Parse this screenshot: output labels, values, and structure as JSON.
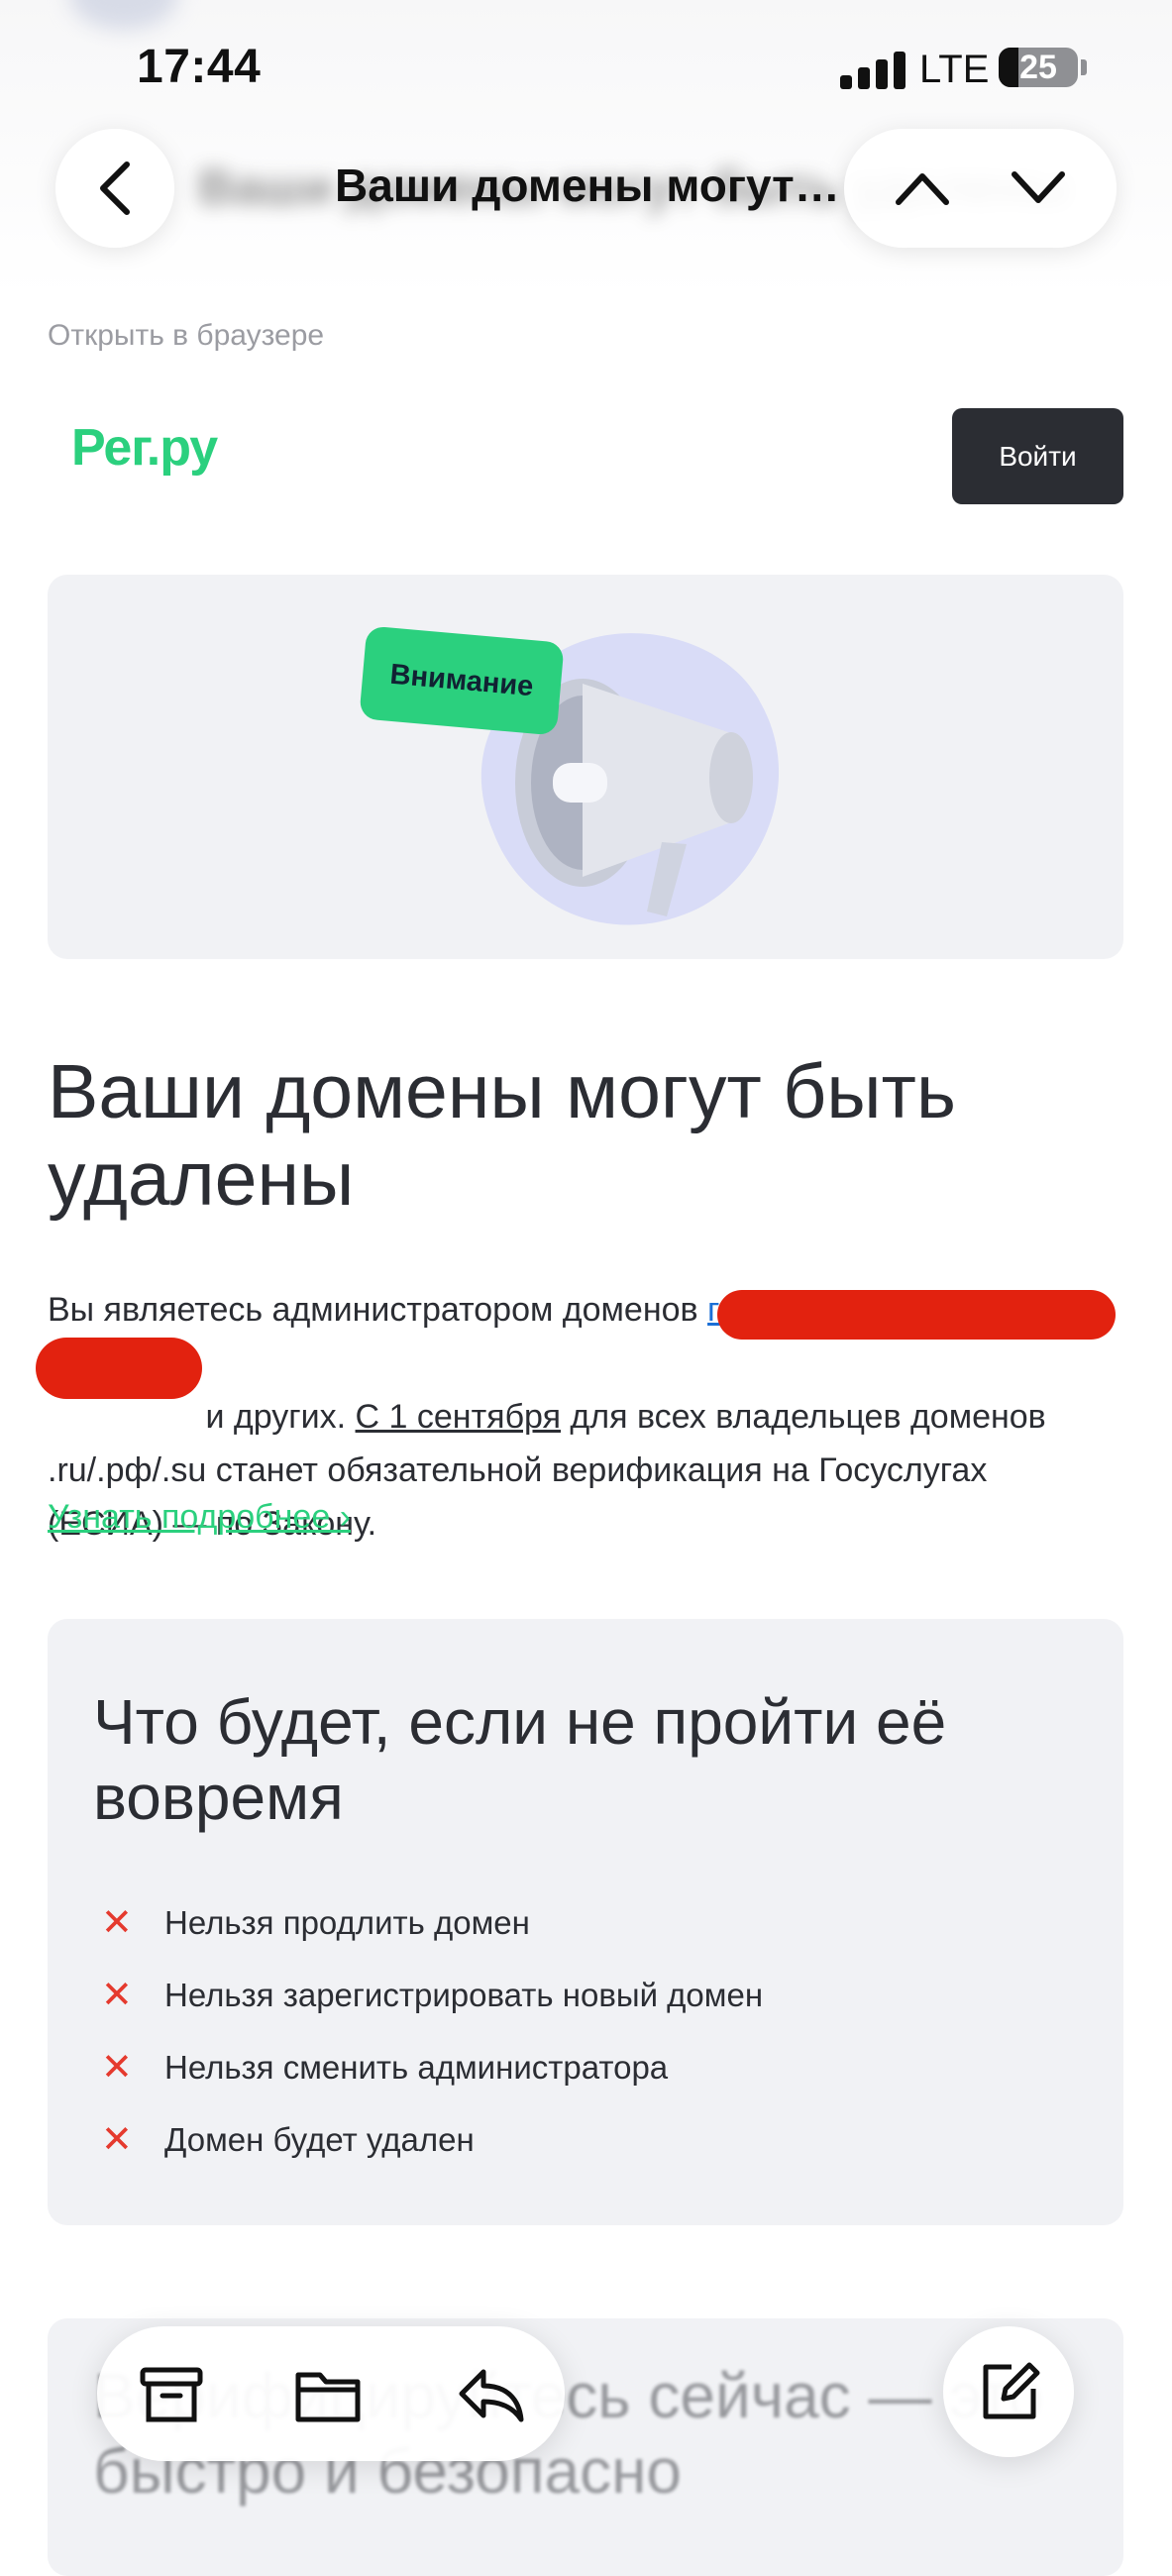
{
  "status_bar": {
    "time": "17:44",
    "network": "LTE",
    "battery": "25",
    "battery_level": 0.25
  },
  "nav": {
    "title": "Ваши домены могут…"
  },
  "email": {
    "open_in_browser": "Открыть в браузере",
    "logo": "Рег.ру",
    "login_label": "Войти",
    "hero_tag": "Внимание",
    "headline": "Ваши домены могут быть удалены",
    "body": {
      "part1": "Вы являетесь администратором доменов ",
      "link_fragment": "г",
      "part2": " и других. ",
      "date_phrase": "С 1 сентября",
      "part3": " для всех владельцев доменов .ru/.рф/.su станет обязательной верификация на Госуслугах (ЕСИА) — по Закону."
    },
    "learn_more": "Узнать подробнее ›",
    "consequences": {
      "title": "Что будет, если не пройти её вовремя",
      "items": [
        "Нельзя продлить домен",
        "Нельзя зарегистрировать новый домен",
        "Нельзя сменить администратора",
        "Домен будет удален"
      ]
    },
    "verify_heading": "Верифицируйтесь сейчас — это быстро и безопасно"
  },
  "colors": {
    "brand_green": "#2bd07e",
    "dark_button": "#2b2d33",
    "redaction": "#e2220f",
    "cross_red": "#e53a2e",
    "card_bg": "#f1f2f5"
  },
  "icons": [
    "back-chevron-icon",
    "chevron-up-icon",
    "chevron-down-icon",
    "archive-icon",
    "folder-icon",
    "reply-icon",
    "compose-icon",
    "megaphone-icon"
  ]
}
